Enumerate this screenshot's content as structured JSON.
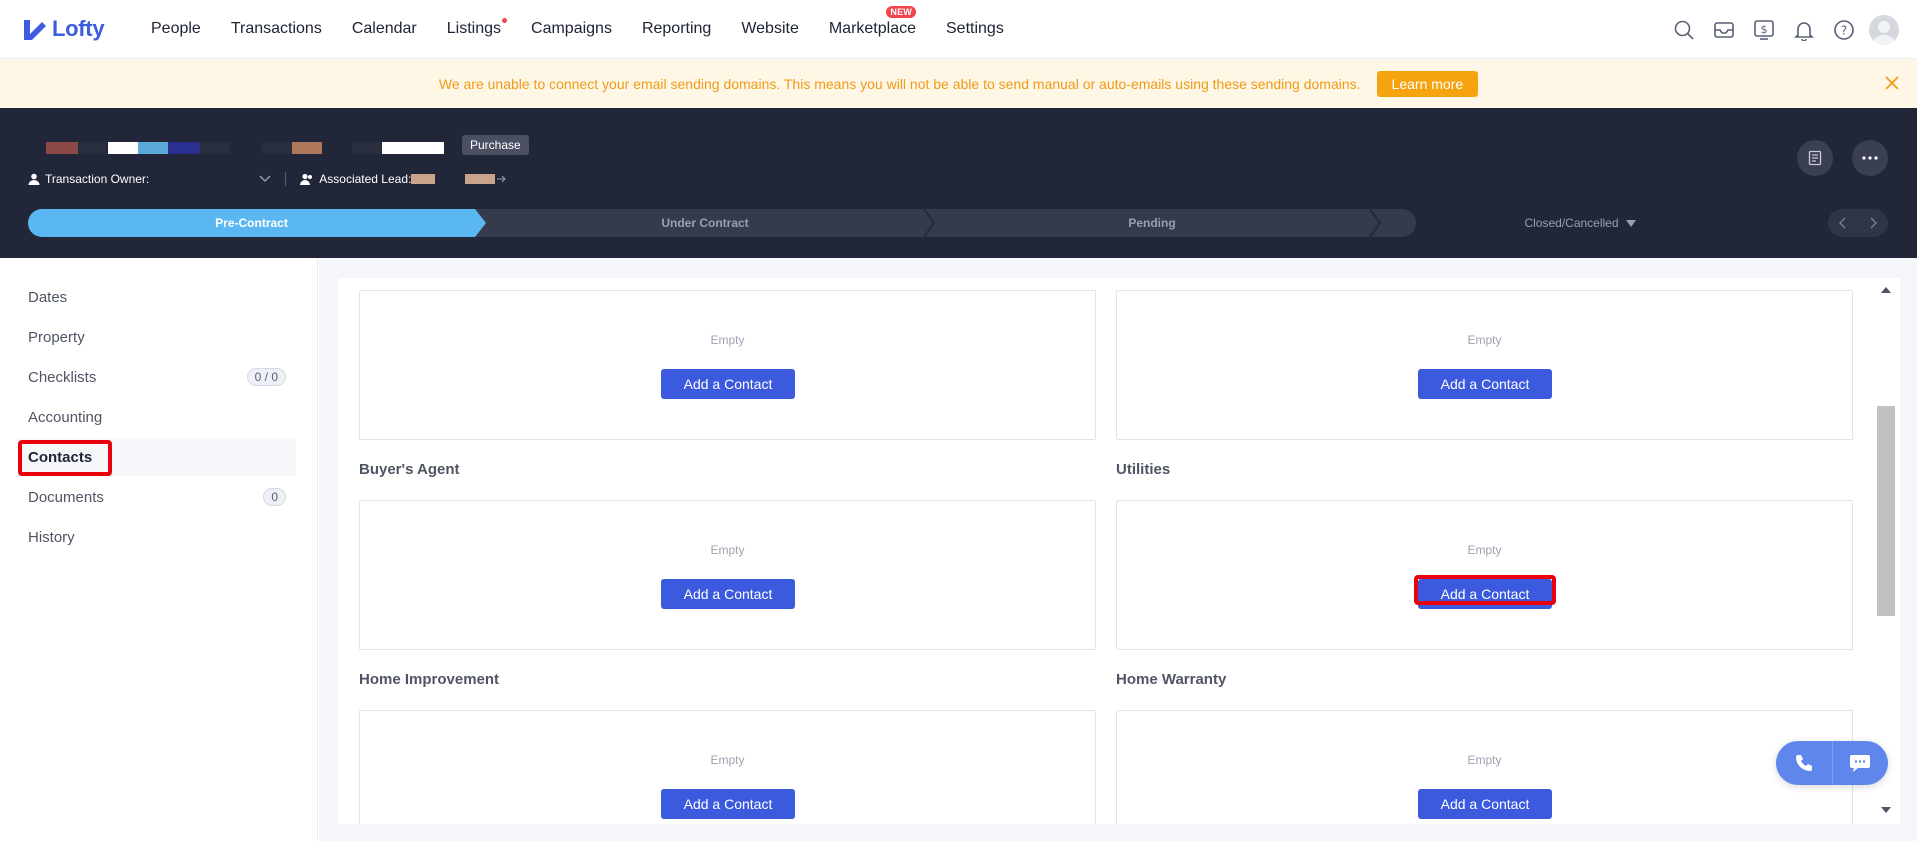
{
  "app": {
    "name": "Lofty",
    "brand_color": "#3d5ce0"
  },
  "nav": {
    "items": [
      "People",
      "Transactions",
      "Calendar",
      "Listings",
      "Campaigns",
      "Reporting",
      "Website",
      "Marketplace",
      "Settings"
    ],
    "new_badge": "NEW",
    "icons": [
      "search-icon",
      "inbox-icon",
      "billing-icon",
      "bell-icon",
      "help-icon",
      "avatar"
    ]
  },
  "banner": {
    "message": "We are unable to connect your email sending domains. This means you will not be able to send manual or auto-emails using these sending domains.",
    "button": "Learn more"
  },
  "transaction": {
    "type_tag": "Purchase",
    "owner_label": "Transaction Owner:",
    "lead_label": "Associated Lead:",
    "stages": [
      "Pre-Contract",
      "Under Contract",
      "Pending",
      "Closed/Cancelled"
    ],
    "active_stage": "Pre-Contract"
  },
  "sidebar": {
    "items": [
      {
        "label": "Dates"
      },
      {
        "label": "Property"
      },
      {
        "label": "Checklists",
        "badge": "0 / 0"
      },
      {
        "label": "Accounting"
      },
      {
        "label": "Contacts"
      },
      {
        "label": "Documents",
        "badge": "0"
      },
      {
        "label": "History"
      }
    ],
    "active": "Contacts"
  },
  "contacts": {
    "empty_text": "Empty",
    "add_label": "Add a Contact",
    "sections": [
      "Buyer's Agent",
      "Utilities",
      "Home Improvement",
      "Home Warranty"
    ]
  }
}
